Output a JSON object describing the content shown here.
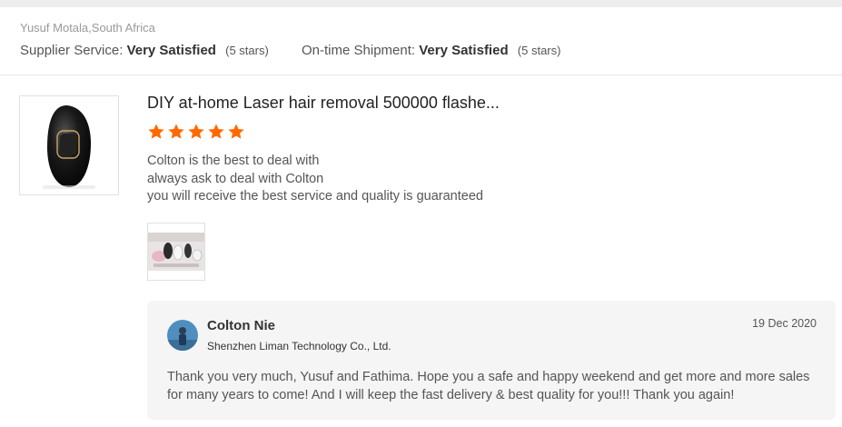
{
  "reviewer": "Yusuf Motala,South Africa",
  "ratings": {
    "supplier_label": "Supplier Service:",
    "supplier_value": "Very Satisfied",
    "supplier_note": "(5 stars)",
    "shipment_label": "On-time Shipment:",
    "shipment_value": "Very Satisfied",
    "shipment_note": "(5 stars)"
  },
  "product": {
    "title": "DIY at-home Laser hair removal 500000 flashe...",
    "rating": 5,
    "star_color": "#ff6a00",
    "thumbnail_icon": "laser-epilator-image"
  },
  "review": {
    "lines": [
      "Colton is the best to deal with",
      "always ask to deal with Colton",
      "you will receive the best service and quality is guaranteed"
    ],
    "photo_icon": "review-photo"
  },
  "reply": {
    "name": "Colton Nie",
    "company": "Shenzhen Liman Technology Co., Ltd.",
    "date": "19 Dec 2020",
    "text": "Thank you very much, Yusuf and Fathima. Hope you a safe and happy weekend and get more and more sales for many years to come! And I will keep the fast delivery & best quality for you!!!  Thank you again!"
  }
}
